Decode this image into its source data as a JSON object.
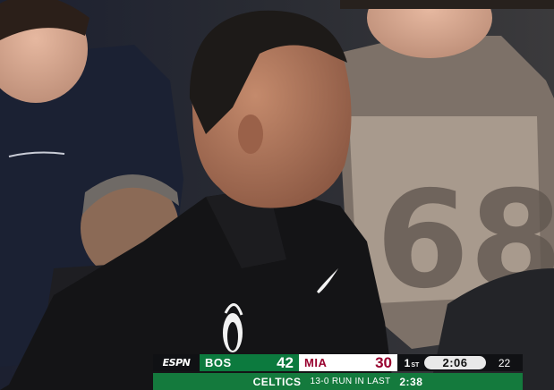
{
  "scene": {
    "description_icons": [
      "miami-heat-logo",
      "nike-swoosh-icon"
    ]
  },
  "scoreboard": {
    "network": "ESPN",
    "away": {
      "abbr": "BOS",
      "score": "42",
      "color": "#0c7a3e"
    },
    "home": {
      "abbr": "MIA",
      "score": "30",
      "color": "#98002e"
    },
    "period": "1",
    "period_suffix": "ST",
    "clock": "2:06",
    "shot_clock": "22"
  },
  "ticker": {
    "team": "CELTICS",
    "run_text": "13-0 RUN IN LAST",
    "time": "2:38",
    "color": "#147a3d"
  }
}
